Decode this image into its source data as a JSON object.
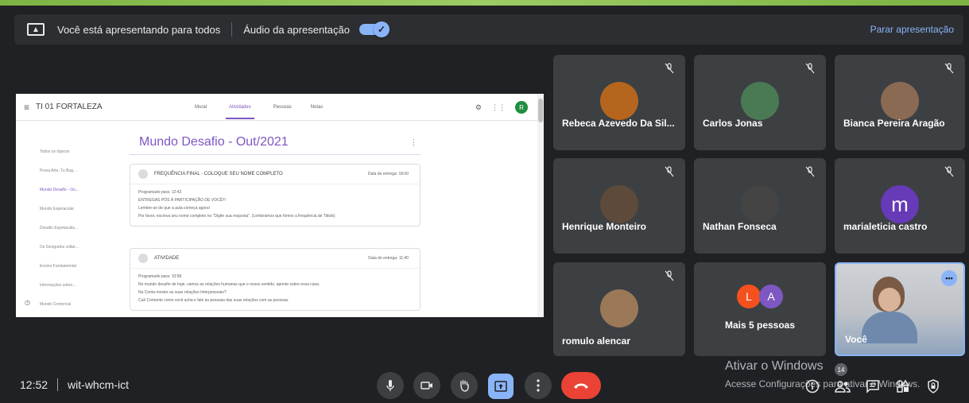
{
  "banner": {
    "presenting_text": "Você está apresentando para todos",
    "audio_label": "Áudio da apresentação",
    "stop_label": "Parar apresentação"
  },
  "classroom": {
    "class_name": "TI 01 FORTALEZA",
    "tabs": [
      "Mural",
      "Atividades",
      "Pessoas",
      "Notas"
    ],
    "active_tab": "Atividades",
    "avatar_letter": "R",
    "sidebar": [
      "Todos os tópicos",
      "Prova Arte, Tu Bug...",
      "Mundo Desafio - Ou...",
      "Mundo Espetacular",
      "Desafio Espetaculis...",
      "Os Geógrafos voltar...",
      "Ensino Fundamental",
      "Informações sobre...",
      "Mundo Comercial"
    ],
    "topic_title": "Mundo Desafio - Out/2021",
    "cards": [
      {
        "title": "FREQUÊNCIA FINAL - COLOQUE SEU NOME COMPLETO",
        "due": "Data de entrega: 18:00",
        "lines": [
          "Programado para: 12:43",
          "ENTREGAS PÓS À PARTICIPAÇÃO DE VOCÊ!!!",
          "Lembre-se de que a aula começa agora!",
          "Por favor, escreva seu nome completo no \"Digite sua resposta\". (Lembramos que fomos a frequência de Tiktok)"
        ]
      },
      {
        "title": "ATIVIDADE",
        "due": "Data de entrega: 11:40",
        "lines": [
          "Programado para: 10:58",
          "No mundo desafio de hoje, vamos as relações humanas que o nosso sentido, aponte sobre essa casa.",
          "",
          "Na Conta mostre as suas relações Interpessoais?",
          "Cuê Comente como você acha e fale às pessoas das suas relações com as pessoas."
        ]
      }
    ]
  },
  "participants": [
    {
      "name": "Rebeca Azevedo Da Sil...",
      "muted": true,
      "avatar_color": "#b5651d"
    },
    {
      "name": "Carlos Jonas",
      "muted": true,
      "avatar_color": "#4a7a54"
    },
    {
      "name": "Bianca Pereira Aragão",
      "muted": true,
      "avatar_color": "#8a6a52"
    },
    {
      "name": "Henrique Monteiro",
      "muted": true,
      "avatar_color": "#5d4a3a"
    },
    {
      "name": "Nathan Fonseca",
      "muted": true,
      "avatar_color": "#444"
    },
    {
      "name": "marialeticia castro",
      "muted": true,
      "avatar_letter": "m",
      "avatar_color": "#673ab7"
    },
    {
      "name": "romulo alencar",
      "muted": true,
      "avatar_color": "#9a7858"
    }
  ],
  "more_tile": {
    "label": "Mais 5 pessoas",
    "avatars": [
      {
        "letter": "L",
        "color": "#f4511e"
      },
      {
        "letter": "A",
        "color": "#7e57c2"
      }
    ]
  },
  "self_tile": {
    "label": "Você"
  },
  "bottom": {
    "time": "12:52",
    "meeting_code": "wit-whcm-ict",
    "participant_count": "14",
    "watermark_title": "Ativar o Windows",
    "watermark_sub": "Acesse Configurações para ativar o Windows."
  },
  "colors": {
    "accent": "#8ab4f8",
    "end_call": "#ea4335",
    "classroom_purple": "#7e57c2"
  }
}
